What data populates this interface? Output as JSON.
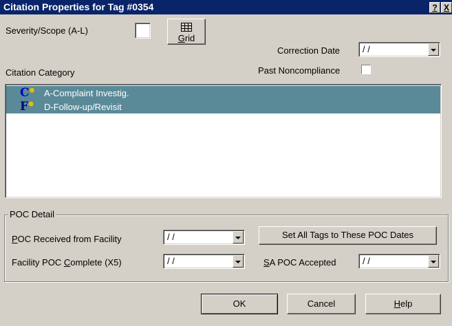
{
  "titlebar": {
    "title": "Citation Properties for Tag #0354",
    "help_glyph": "?",
    "close_glyph": "X"
  },
  "severity": {
    "label": "Severity/Scope (A-L)",
    "value": ""
  },
  "grid_button": {
    "label": "Grid",
    "icon": "grid-icon"
  },
  "correction_date": {
    "label": "Correction Date",
    "value": "/ /"
  },
  "past_noncompliance": {
    "label": "Past Noncompliance",
    "checked": false
  },
  "citation_category": {
    "label": "Citation Category",
    "items": [
      {
        "icon_letter": "C",
        "text": "A-Complaint Investig.",
        "color": "#0000cc"
      },
      {
        "icon_letter": "F",
        "text": "D-Follow-up/Revisit",
        "color": "#000080"
      }
    ]
  },
  "poc_detail": {
    "label": "POC Detail",
    "received": {
      "label": "POC Received from Facility",
      "value": "/ /"
    },
    "complete": {
      "label": "Facility POC Complete (X5)",
      "value": "/ /"
    },
    "set_all_button": "Set All Tags to These POC Dates",
    "sa_accepted": {
      "label": "SA POC Accepted",
      "value": "/ /"
    }
  },
  "footer": {
    "ok": "OK",
    "cancel": "Cancel",
    "help": "Help"
  }
}
